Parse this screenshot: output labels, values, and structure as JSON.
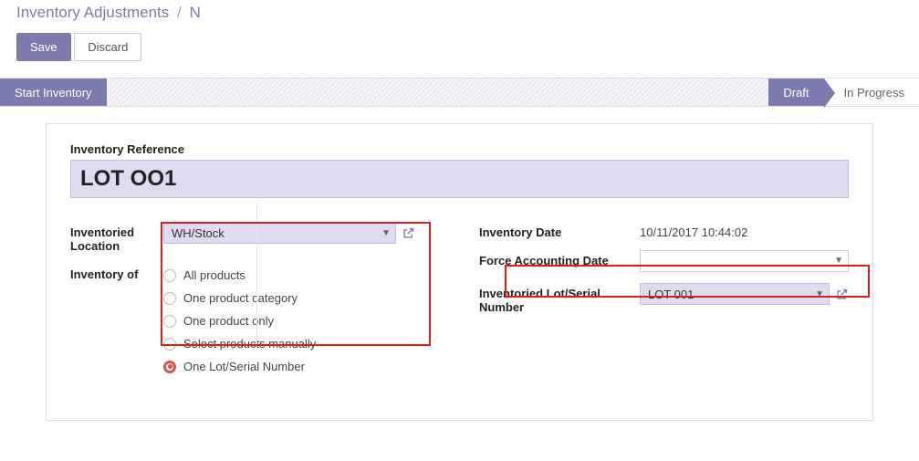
{
  "breadcrumb": {
    "parent": "Inventory Adjustments",
    "sep": "/",
    "current": "N"
  },
  "buttons": {
    "save": "Save",
    "discard": "Discard",
    "start_inventory": "Start Inventory"
  },
  "status": {
    "draft": "Draft",
    "in_progress": "In Progress"
  },
  "form": {
    "reference_label": "Inventory Reference",
    "reference_value": "LOT OO1",
    "location_label": "Inventoried Location",
    "location_value": "WH/Stock",
    "inventory_of_label": "Inventory of",
    "inventory_of_options": [
      "All products",
      "One product category",
      "One product only",
      "Select products manually",
      "One Lot/Serial Number"
    ],
    "inventory_of_selected_index": 4,
    "date_label": "Inventory Date",
    "date_value": "10/11/2017 10:44:02",
    "force_date_label": "Force Accounting Date",
    "force_date_value": "",
    "lot_label": "Inventoried Lot/Serial Number",
    "lot_value": "LOT 001"
  }
}
